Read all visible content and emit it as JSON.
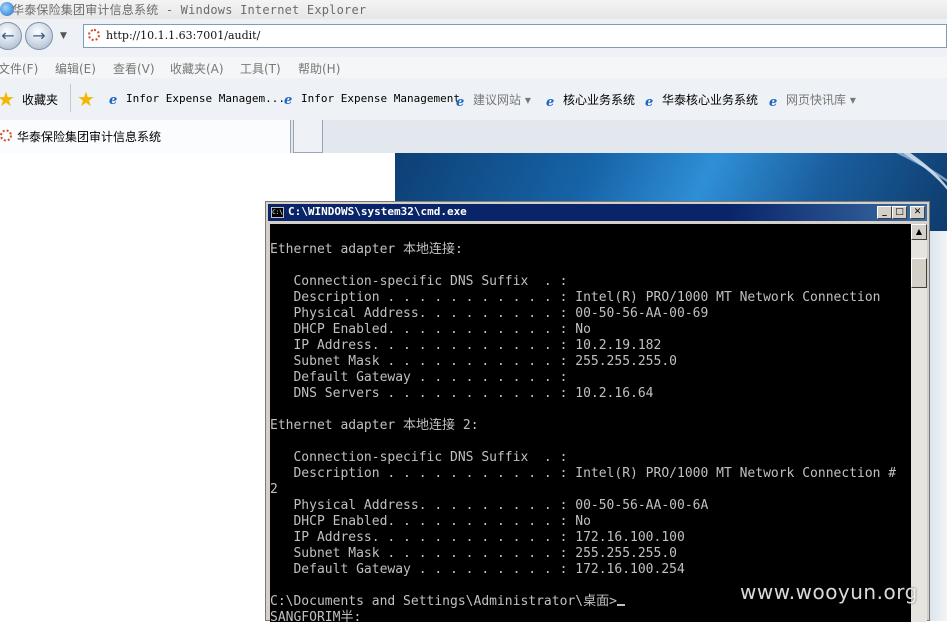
{
  "window": {
    "title": "华泰保险集团审计信息系统 - Windows Internet Explorer"
  },
  "address_bar": {
    "url": "http://10.1.1.63:7001/audit/"
  },
  "menu": [
    "文件(F)",
    "编辑(E)",
    "查看(V)",
    "收藏夹(A)",
    "工具(T)",
    "帮助(H)"
  ],
  "favorites": {
    "label": "收藏夹",
    "items": [
      "Infor Expense Managem...",
      "Infor Expense Management",
      "建议网站 ▾",
      "核心业务系统",
      "华泰核心业务系统",
      "网页快讯库 ▾"
    ]
  },
  "tab": {
    "label": "华泰保险集团审计信息系统"
  },
  "cmd": {
    "title": "C:\\WINDOWS\\system32\\cmd.exe",
    "lines": [
      "",
      "Ethernet adapter 本地连接:",
      "",
      "   Connection-specific DNS Suffix  . :",
      "   Description . . . . . . . . . . . : Intel(R) PRO/1000 MT Network Connection",
      "   Physical Address. . . . . . . . . : 00-50-56-AA-00-69",
      "   DHCP Enabled. . . . . . . . . . . : No",
      "   IP Address. . . . . . . . . . . . : 10.2.19.182",
      "   Subnet Mask . . . . . . . . . . . : 255.255.255.0",
      "   Default Gateway . . . . . . . . . :",
      "   DNS Servers . . . . . . . . . . . : 10.2.16.64",
      "",
      "Ethernet adapter 本地连接 2:",
      "",
      "   Connection-specific DNS Suffix  . :",
      "   Description . . . . . . . . . . . : Intel(R) PRO/1000 MT Network Connection #",
      "2",
      "   Physical Address. . . . . . . . . : 00-50-56-AA-00-6A",
      "   DHCP Enabled. . . . . . . . . . . : No",
      "   IP Address. . . . . . . . . . . . : 172.16.100.100",
      "   Subnet Mask . . . . . . . . . . . : 255.255.255.0",
      "   Default Gateway . . . . . . . . . : 172.16.100.254",
      ""
    ],
    "prompt": "C:\\Documents and Settings\\Administrator\\桌面>",
    "last_line": "SANGFORIM半:"
  },
  "watermark": "www.wooyun.org"
}
